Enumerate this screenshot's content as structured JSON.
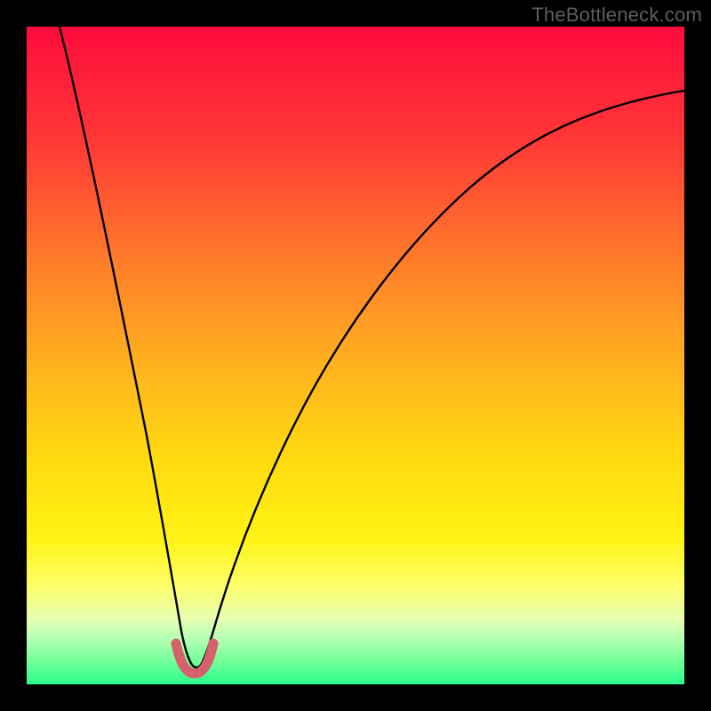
{
  "watermark": "TheBottleneck.com",
  "chart_data": {
    "type": "line",
    "title": "",
    "xlabel": "",
    "ylabel": "",
    "xlim": [
      0,
      100
    ],
    "ylim": [
      0,
      100
    ],
    "x": [
      5,
      10,
      15,
      18,
      20,
      22,
      24,
      25,
      26,
      28,
      30,
      35,
      40,
      45,
      50,
      55,
      60,
      65,
      70,
      75,
      80,
      85,
      90,
      95,
      100
    ],
    "values": [
      100,
      76,
      53,
      38,
      28,
      18,
      8,
      3,
      7,
      17,
      26,
      42,
      52,
      59,
      65,
      70,
      74,
      77,
      80,
      82,
      84,
      86,
      87,
      88,
      89
    ],
    "annotations": [],
    "background_gradient": [
      "#ff0b3d",
      "#ff5d33",
      "#ffb31e",
      "#ffe80c",
      "#fff85e",
      "#7dff7d",
      "#28ff8c"
    ],
    "valley_marker": {
      "x_range": [
        22.5,
        27.5
      ],
      "y": 3,
      "color": "#d6606b"
    }
  }
}
